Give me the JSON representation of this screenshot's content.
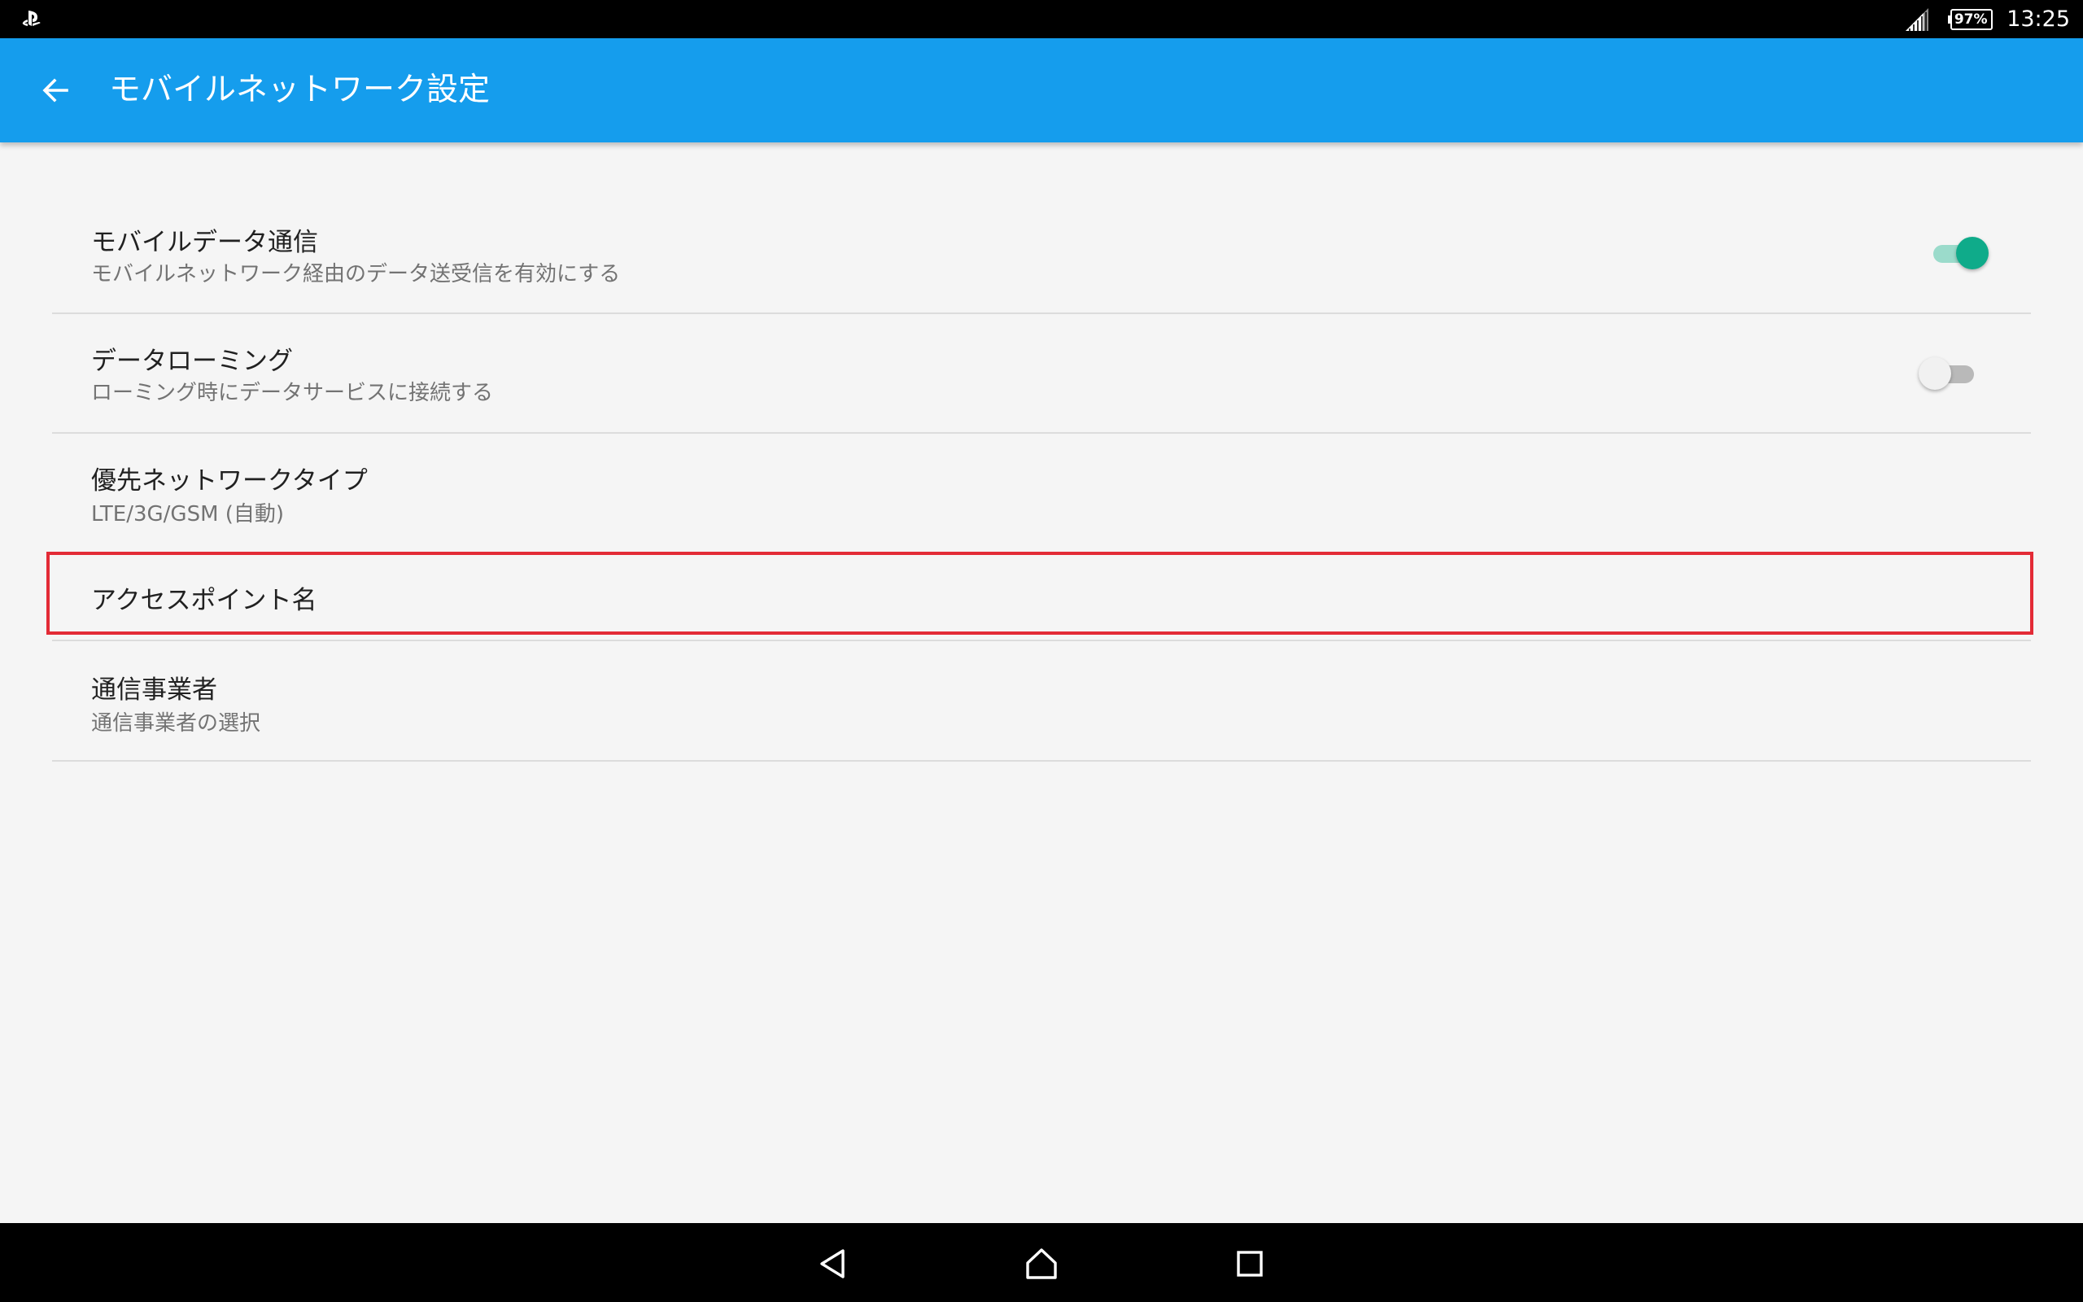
{
  "status_bar": {
    "notification_icon": "playstation-icon",
    "battery": "97%",
    "time": "13:25"
  },
  "app_bar": {
    "title": "モバイルネットワーク設定",
    "back_icon": "arrow-back-icon"
  },
  "settings": {
    "items": [
      {
        "title": "モバイルデータ通信",
        "summary": "モバイルネットワーク経由のデータ送受信を有効にする",
        "switch": "on"
      },
      {
        "title": "データローミング",
        "summary": "ローミング時にデータサービスに接続する",
        "switch": "off"
      },
      {
        "title": "優先ネットワークタイプ",
        "summary": "LTE/3G/GSM (自動)"
      },
      {
        "title": "アクセスポイント名",
        "highlighted": true
      },
      {
        "title": "通信事業者",
        "summary": "通信事業者の選択"
      }
    ]
  },
  "colors": {
    "app_bar": "#159ded",
    "switch_on": "#0fab8a",
    "highlight_border": "#e32b36",
    "background": "#f5f5f5"
  },
  "nav_bar": {
    "back_icon": "nav-back-icon",
    "home_icon": "nav-home-icon",
    "recents_icon": "nav-recents-icon"
  }
}
